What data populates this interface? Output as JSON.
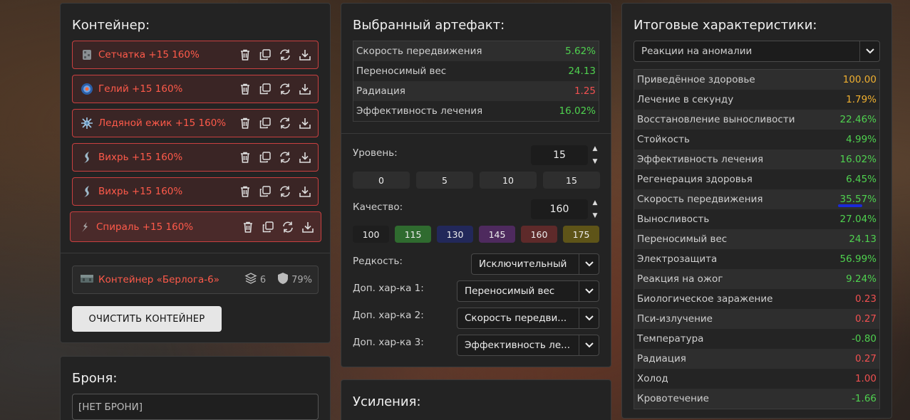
{
  "container_panel": {
    "title": "Контейнер:",
    "slots": [
      {
        "label": "Сетчатка +15 160%",
        "icon": "setchatka-artifact-icon"
      },
      {
        "label": "Гелий +15 160%",
        "icon": "geliy-artifact-icon"
      },
      {
        "label": "Ледяной ежик +15 160%",
        "icon": "ice-hedgehog-artifact-icon"
      },
      {
        "label": "Вихрь +15 160%",
        "icon": "vortex-artifact-icon"
      },
      {
        "label": "Вихрь +15 160%",
        "icon": "vortex-artifact-icon"
      },
      {
        "label": "Спираль +15 160%",
        "icon": "spiral-artifact-icon"
      }
    ],
    "container": {
      "name": "Контейнер «Берлога-6»",
      "slots_count": "6",
      "protection": "79%"
    },
    "clear_button": "ОЧИСТИТЬ КОНТЕЙНЕР"
  },
  "armor_panel": {
    "title": "Броня:",
    "value": "[НЕТ БРОНИ]"
  },
  "artifact_panel": {
    "title": "Выбранный артефакт:",
    "stats": [
      {
        "name": "Скорость передвижения",
        "value": "5.62%",
        "color": "green"
      },
      {
        "name": "Переносимый вес",
        "value": "24.13",
        "color": "green"
      },
      {
        "name": "Радиация",
        "value": "1.25",
        "color": "red"
      },
      {
        "name": "Эффективность лечения",
        "value": "16.02%",
        "color": "green"
      }
    ],
    "level_label": "Уровень:",
    "level_value": "15",
    "level_presets": [
      "0",
      "5",
      "10",
      "15"
    ],
    "quality_label": "Качество:",
    "quality_value": "160",
    "quality_presets": [
      {
        "label": "100",
        "color": "#1e1e1e"
      },
      {
        "label": "115",
        "color": "#2f6b2f"
      },
      {
        "label": "130",
        "color": "#22285a"
      },
      {
        "label": "145",
        "color": "#4e2a5e"
      },
      {
        "label": "160",
        "color": "#5e2a2a"
      },
      {
        "label": "175",
        "color": "#5e5418"
      }
    ],
    "rarity_label": "Редкость:",
    "rarity_value": "Исключительный",
    "extra1_label": "Доп. хар-ка 1:",
    "extra1_value": "Переносимый вес",
    "extra2_label": "Доп. хар-ка 2:",
    "extra2_value": "Скорость передви...",
    "extra3_label": "Доп. хар-ка 3:",
    "extra3_value": "Эффективность ле..."
  },
  "boost_panel": {
    "title": "Усиления:"
  },
  "summary_panel": {
    "title": "Итоговые характеристики:",
    "filter_value": "Реакции на аномалии",
    "stats": [
      {
        "name": "Приведённое здоровье",
        "value": "100.00",
        "color": "yellow"
      },
      {
        "name": "Лечение в секунду",
        "value": "1.79%",
        "color": "yellow"
      },
      {
        "name": "Восстановление выносливости",
        "value": "22.46%",
        "color": "green"
      },
      {
        "name": "Стойкость",
        "value": "4.99%",
        "color": "green"
      },
      {
        "name": "Эффективность лечения",
        "value": "16.02%",
        "color": "green"
      },
      {
        "name": "Регенерация здоровья",
        "value": "6.45%",
        "color": "green"
      },
      {
        "name": "Скорость передвижения",
        "value": "35.57%",
        "color": "green"
      },
      {
        "name": "Выносливость",
        "value": "27.04%",
        "color": "green"
      },
      {
        "name": "Переносимый вес",
        "value": "24.13",
        "color": "green"
      },
      {
        "name": "Электрозащита",
        "value": "56.99%",
        "color": "green"
      },
      {
        "name": "Реакция на ожог",
        "value": "9.24%",
        "color": "green"
      },
      {
        "name": "Биологическое заражение",
        "value": "0.23",
        "color": "red"
      },
      {
        "name": "Пси-излучение",
        "value": "0.27",
        "color": "red"
      },
      {
        "name": "Температура",
        "value": "-0.80",
        "color": "green"
      },
      {
        "name": "Радиация",
        "value": "0.27",
        "color": "red"
      },
      {
        "name": "Холод",
        "value": "1.00",
        "color": "red"
      },
      {
        "name": "Кровотечение",
        "value": "-1.66",
        "color": "green"
      }
    ]
  }
}
